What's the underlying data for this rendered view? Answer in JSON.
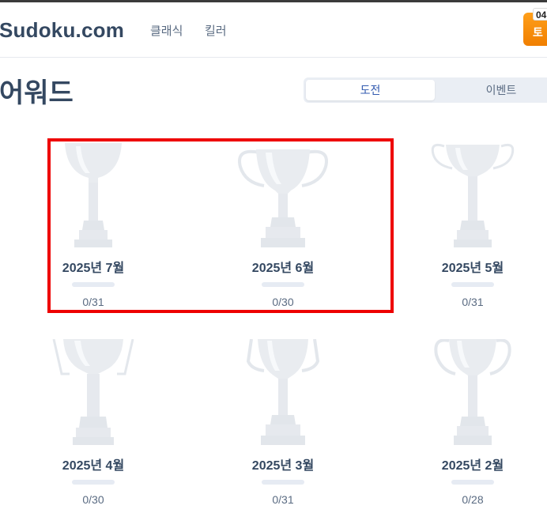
{
  "header": {
    "logo": "Sudoku.com",
    "nav": [
      "클래식",
      "킬러"
    ],
    "promo_text": "토",
    "promo_badge": "04"
  },
  "page": {
    "title": "어워드"
  },
  "tabs": {
    "challenge": "도전",
    "events": "이벤트"
  },
  "awards": [
    {
      "label": "2025년 7월",
      "progress": "0/31",
      "trophy": "trophy-icon"
    },
    {
      "label": "2025년 6월",
      "progress": "0/30",
      "trophy": "trophy-icon"
    },
    {
      "label": "2025년 5월",
      "progress": "0/31",
      "trophy": "trophy-icon"
    },
    {
      "label": "2025년 4월",
      "progress": "0/30",
      "trophy": "trophy-icon"
    },
    {
      "label": "2025년 3월",
      "progress": "0/31",
      "trophy": "trophy-icon"
    },
    {
      "label": "2025년 2월",
      "progress": "0/28",
      "trophy": "trophy-icon"
    }
  ],
  "colors": {
    "title": "#344861",
    "active_tab": "#325aaf",
    "highlight": "#ee0000",
    "promo": "#f07f00"
  }
}
